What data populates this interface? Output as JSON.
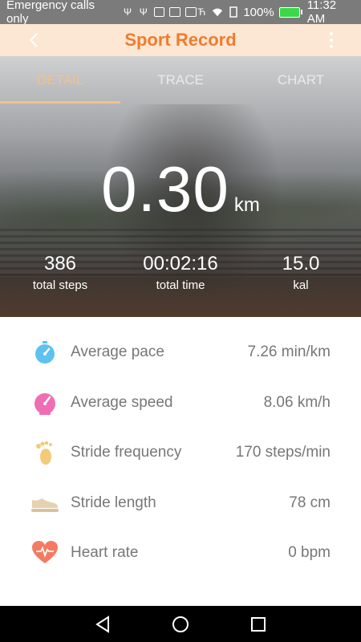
{
  "status_bar": {
    "carrier_text": "Emergency calls only",
    "battery": "100%",
    "time": "11:32 AM"
  },
  "header": {
    "title": "Sport Record"
  },
  "tabs": [
    {
      "label": "DETAIL",
      "active": true
    },
    {
      "label": "TRACE",
      "active": false
    },
    {
      "label": "CHART",
      "active": false
    }
  ],
  "summary": {
    "distance_value": "0.30",
    "distance_unit": "km",
    "stats": [
      {
        "value": "386",
        "label": "total steps"
      },
      {
        "value": "00:02:16",
        "label": "total time"
      },
      {
        "value": "15.0",
        "label": "kal"
      }
    ]
  },
  "metrics": [
    {
      "icon": "stopwatch-icon",
      "label": "Average pace",
      "value": "7.26 min/km",
      "color": "#5ec2ef"
    },
    {
      "icon": "speedometer-icon",
      "label": "Average speed",
      "value": "8.06 km/h",
      "color": "#f06db3"
    },
    {
      "icon": "footprint-icon",
      "label": "Stride frequency",
      "value": "170 steps/min",
      "color": "#f5c97a"
    },
    {
      "icon": "shoe-icon",
      "label": "Stride length",
      "value": "78 cm",
      "color": "#e6d2b0"
    },
    {
      "icon": "heart-icon",
      "label": "Heart rate",
      "value": "0 bpm",
      "color": "#f47b62"
    }
  ],
  "colors": {
    "accent": "#f07c2d",
    "header_bg": "#fbe7d3",
    "tab_active": "#f3c08c"
  }
}
